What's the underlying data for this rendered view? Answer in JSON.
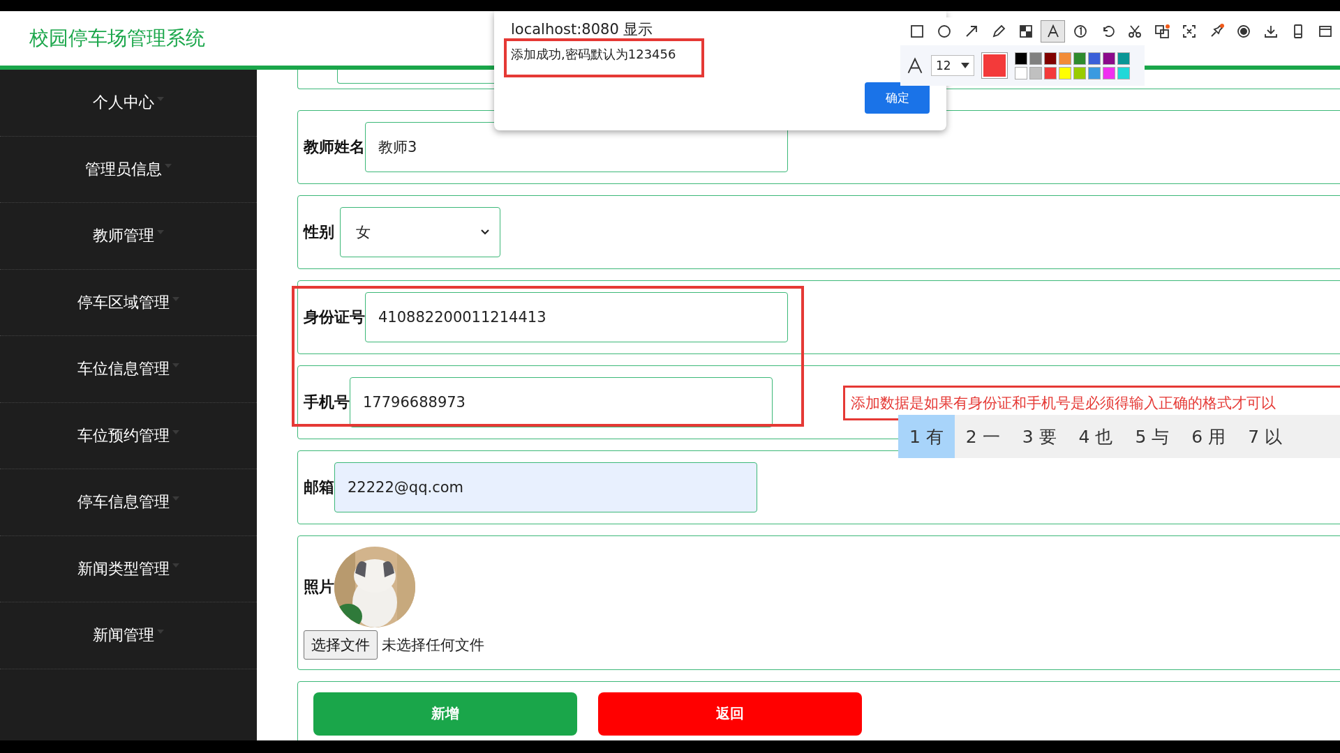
{
  "header": {
    "title": "校园停车场管理系统"
  },
  "sidebar": {
    "items": [
      "个人中心",
      "管理员信息",
      "教师管理",
      "停车区域管理",
      "车位信息管理",
      "车位预约管理",
      "停车信息管理",
      "新闻类型管理",
      "新闻管理"
    ]
  },
  "form": {
    "fields": [
      {
        "kind": "text",
        "label": "教师姓名",
        "value": "教师3",
        "autofilled": false
      },
      {
        "kind": "select",
        "label": "性别",
        "value": "女"
      },
      {
        "kind": "text",
        "label": "身份证号",
        "value": "410882200011214413",
        "autofilled": false
      },
      {
        "kind": "text",
        "label": "手机号",
        "value": "17796688973",
        "autofilled": false
      },
      {
        "kind": "text",
        "label": "邮箱",
        "value": "22222@qq.com",
        "autofilled": true
      },
      {
        "kind": "file",
        "label": "照片",
        "button": "选择文件",
        "status": "未选择任何文件"
      }
    ],
    "buttons": [
      {
        "kind": "primary",
        "label": "新增"
      },
      {
        "kind": "danger",
        "label": "返回"
      }
    ]
  },
  "alert": {
    "title": "localhost:8080 显示",
    "message": "添加成功,密码默认为123456",
    "button": "确定"
  },
  "annotation_toolbar": {
    "tools": [
      {
        "kind": "rectangle",
        "selected": false
      },
      {
        "kind": "ellipse",
        "selected": false
      },
      {
        "kind": "arrow",
        "selected": false
      },
      {
        "kind": "pencil",
        "selected": false
      },
      {
        "kind": "mosaic",
        "selected": false
      },
      {
        "kind": "text",
        "selected": true
      },
      {
        "kind": "number",
        "selected": false
      },
      {
        "kind": "undo",
        "selected": false
      },
      {
        "kind": "scissors",
        "selected": false
      },
      {
        "kind": "translate",
        "selected": false
      },
      {
        "kind": "expand",
        "selected": false
      },
      {
        "kind": "pin",
        "selected": false
      },
      {
        "kind": "record",
        "selected": false
      },
      {
        "kind": "download",
        "selected": false
      },
      {
        "kind": "phone",
        "selected": false
      },
      {
        "kind": "window",
        "selected": false
      }
    ],
    "font_size": "12",
    "palette": [
      {
        "color": "#000000"
      },
      {
        "color": "#808080"
      },
      {
        "color": "#800000"
      },
      {
        "color": "#f28c38"
      },
      {
        "color": "#2e8b2e"
      },
      {
        "color": "#3a5fd9"
      },
      {
        "color": "#8b0a8b"
      },
      {
        "color": "#0a9696"
      },
      {
        "color": "#ffffff"
      },
      {
        "color": "#c0c0c0"
      },
      {
        "color": "#f33a3a"
      },
      {
        "color": "#ffff00"
      },
      {
        "color": "#99cc00"
      },
      {
        "color": "#3a9ae0"
      },
      {
        "color": "#f030f0"
      },
      {
        "color": "#20d8d8"
      }
    ]
  },
  "annotation_text": "添加数据是如果有身份证和手机号是必须得输入正确的格式才可以",
  "ime": {
    "candidates": [
      {
        "number": "1",
        "text": "有",
        "selected": true
      },
      {
        "number": "2",
        "text": "一",
        "selected": false
      },
      {
        "number": "3",
        "text": "要",
        "selected": false
      },
      {
        "number": "4",
        "text": "也",
        "selected": false
      },
      {
        "number": "5",
        "text": "与",
        "selected": false
      },
      {
        "number": "6",
        "text": "用",
        "selected": false
      },
      {
        "number": "7",
        "text": "以",
        "selected": false
      }
    ]
  }
}
